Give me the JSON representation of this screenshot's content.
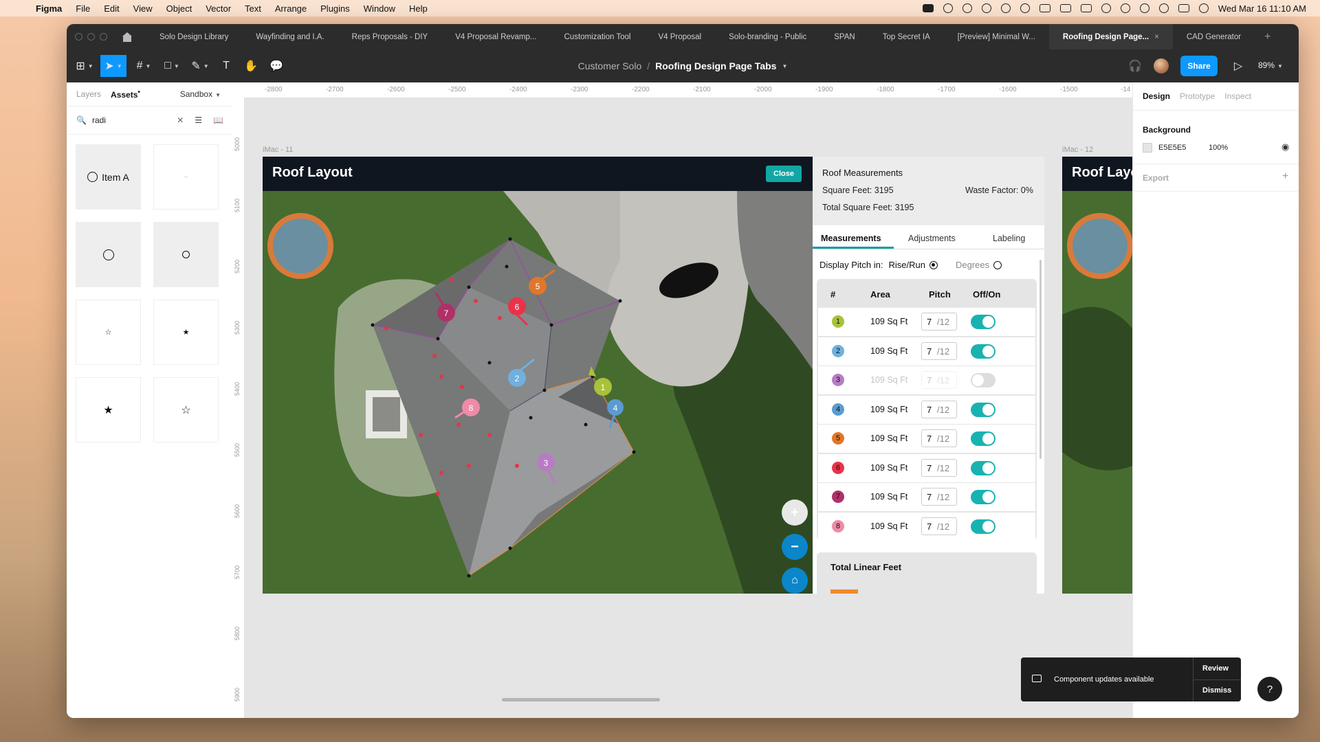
{
  "menubar": {
    "app": "Figma",
    "items": [
      "File",
      "Edit",
      "View",
      "Object",
      "Vector",
      "Text",
      "Arrange",
      "Plugins",
      "Window",
      "Help"
    ],
    "datetime": "Wed Mar 16  11:10 AM"
  },
  "tabs": [
    {
      "label": "Solo Design Library"
    },
    {
      "label": "Wayfinding and I.A."
    },
    {
      "label": "Reps Proposals - DIY"
    },
    {
      "label": "V4 Proposal Revamp..."
    },
    {
      "label": "Customization Tool"
    },
    {
      "label": "V4 Proposal"
    },
    {
      "label": "Solo-branding - Public"
    },
    {
      "label": "SPAN"
    },
    {
      "label": "Top Secret IA"
    },
    {
      "label": "[Preview] Minimal W..."
    },
    {
      "label": "Roofing Design Page..."
    },
    {
      "label": "CAD Generator"
    }
  ],
  "toolbar": {
    "project": "Customer Solo",
    "separator": "/",
    "file": "Roofing Design Page Tabs",
    "share": "Share",
    "zoom": "89%"
  },
  "left_panel": {
    "tabs": [
      "Layers",
      "Assets"
    ],
    "assets_marker": "•",
    "library": "Sandbox",
    "search_value": "radi",
    "asset_item_label": "Item A",
    "asset_dash": "–"
  },
  "rulers": {
    "top": [
      "-2800",
      "-2700",
      "-2600",
      "-2500",
      "-2400",
      "-2300",
      "-2200",
      "-2100",
      "-2000",
      "-1900",
      "-1800",
      "-1700",
      "-1600",
      "-1500",
      "-14"
    ],
    "left": [
      "5000",
      "5100",
      "5200",
      "5300",
      "5400",
      "5500",
      "5600",
      "5700",
      "5800",
      "5900"
    ]
  },
  "frames": {
    "frame1": "iMac - 11",
    "frame2": "iMac - 12"
  },
  "roof": {
    "title": "Roof Layout",
    "close": "Close",
    "measurements": {
      "title": "Roof Measurements",
      "square_feet": "Square Feet: 3195",
      "waste_factor": "Waste Factor: 0%",
      "total_square_feet": "Total Square Feet: 3195"
    },
    "tabs": [
      "Measurements",
      "Adjustments",
      "Labeling"
    ],
    "display_pitch": {
      "label": "Display Pitch in:",
      "option_a": "Rise/Run",
      "option_b": "Degrees",
      "selected": "Rise/Run"
    },
    "table": {
      "headers": [
        "#",
        "Area",
        "Pitch",
        "Off/On"
      ],
      "rows": [
        {
          "n": "1",
          "color": "#a8c23a",
          "area": "109 Sq Ft",
          "pitch": "7",
          "den": "/12",
          "on": true
        },
        {
          "n": "2",
          "color": "#6fb0e0",
          "area": "109 Sq Ft",
          "pitch": "7",
          "den": "/12",
          "on": true
        },
        {
          "n": "3",
          "color": "#b77cc3",
          "area": "109 Sq Ft",
          "pitch": "7",
          "den": "/12",
          "on": false
        },
        {
          "n": "4",
          "color": "#5b9bd1",
          "area": "109 Sq Ft",
          "pitch": "7",
          "den": "/12",
          "on": true
        },
        {
          "n": "5",
          "color": "#e0772a",
          "area": "109 Sq Ft",
          "pitch": "7",
          "den": "/12",
          "on": true
        },
        {
          "n": "6",
          "color": "#e8334a",
          "area": "109 Sq Ft",
          "pitch": "7",
          "den": "/12",
          "on": true
        },
        {
          "n": "7",
          "color": "#b03068",
          "area": "109 Sq Ft",
          "pitch": "7",
          "den": "/12",
          "on": true
        },
        {
          "n": "8",
          "color": "#ee8ba6",
          "area": "109 Sq Ft",
          "pitch": "7",
          "den": "/12",
          "on": true
        }
      ]
    },
    "total_linear": "Total Linear Feet",
    "markers": [
      "1",
      "2",
      "3",
      "4",
      "5",
      "6",
      "7",
      "8"
    ]
  },
  "frame2_title": "Roof Layout",
  "right_panel": {
    "tabs": [
      "Design",
      "Prototype",
      "Inspect"
    ],
    "background_label": "Background",
    "bg_hex": "E5E5E5",
    "bg_opacity": "100%",
    "export_label": "Export"
  },
  "toast": {
    "message": "Component updates available",
    "review": "Review",
    "dismiss": "Dismiss"
  },
  "help": "?"
}
